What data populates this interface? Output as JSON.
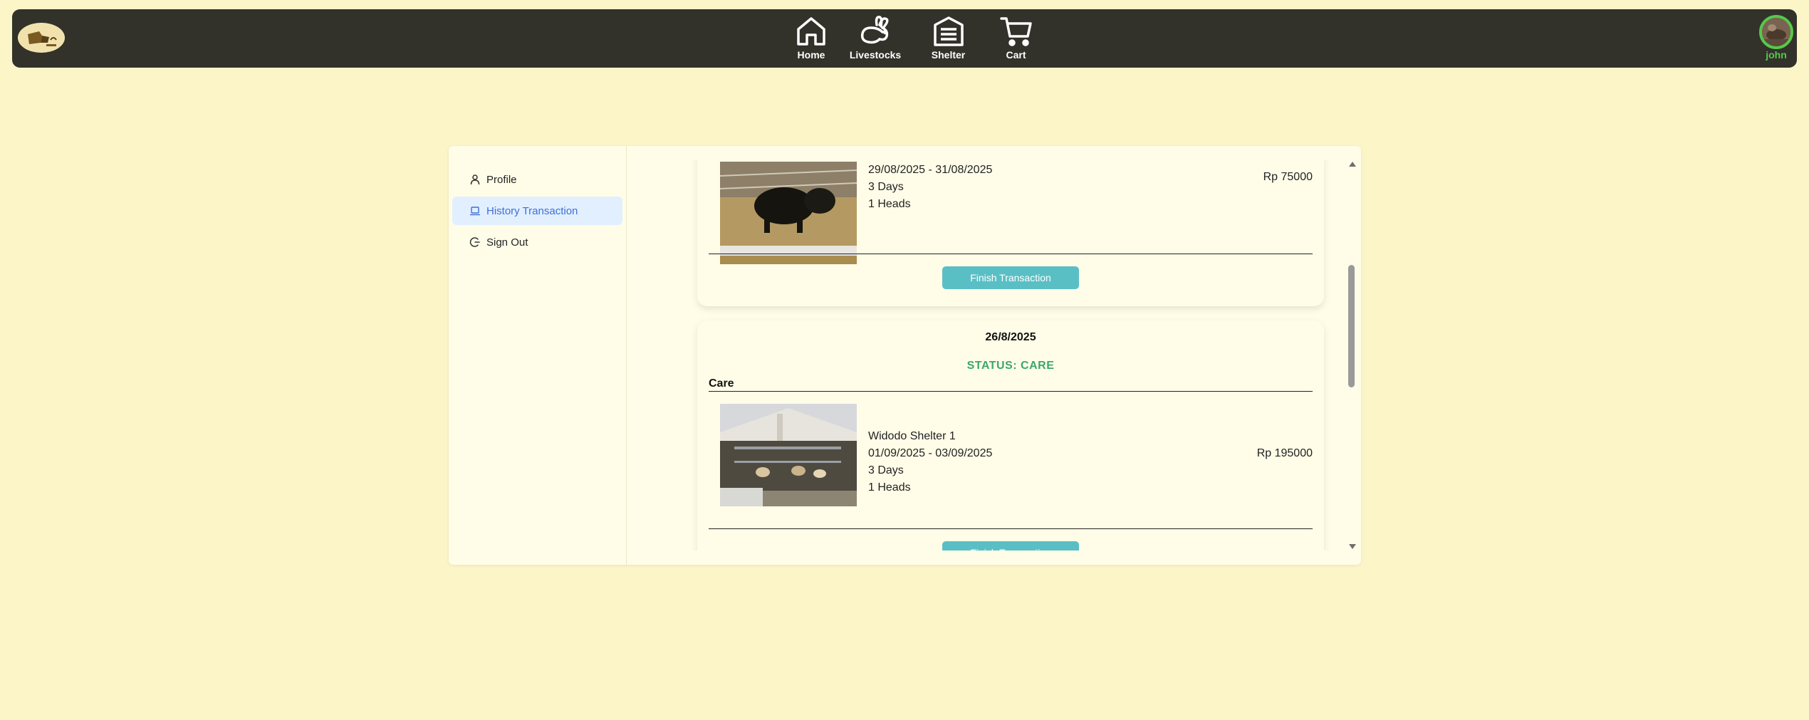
{
  "nav": {
    "items": [
      {
        "label": "Home",
        "icon": "home-icon"
      },
      {
        "label": "Livestocks",
        "icon": "rabbit-icon"
      },
      {
        "label": "Shelter",
        "icon": "garage-icon"
      },
      {
        "label": "Cart",
        "icon": "cart-icon"
      }
    ],
    "user_name": "john",
    "colors": {
      "bar": "#32322a",
      "user_accent": "#55c94b"
    }
  },
  "sidebar": {
    "items": [
      {
        "label": "Profile",
        "icon": "user-icon",
        "active": false
      },
      {
        "label": "History Transaction",
        "icon": "laptop-icon",
        "active": true
      },
      {
        "label": "Sign Out",
        "icon": "logout-icon",
        "active": false
      }
    ]
  },
  "transactions": [
    {
      "item": {
        "date_range": "29/08/2025 - 31/08/2025",
        "duration": "3 Days",
        "heads": "1 Heads",
        "price": "Rp 75000"
      },
      "button_label": "Finish Transaction"
    },
    {
      "date": "26/8/2025",
      "status": "STATUS: CARE",
      "type": "Care",
      "item": {
        "name": "Widodo Shelter 1",
        "date_range": "01/09/2025 - 03/09/2025",
        "duration": "3 Days",
        "heads": "1 Heads",
        "price": "Rp 195000"
      },
      "button_label": "Finish Transaction"
    }
  ],
  "colors": {
    "background": "#fcf5c8",
    "status_green": "#3aa86a",
    "button": "#5abfc4",
    "active_blue": "#3d6fd9"
  }
}
